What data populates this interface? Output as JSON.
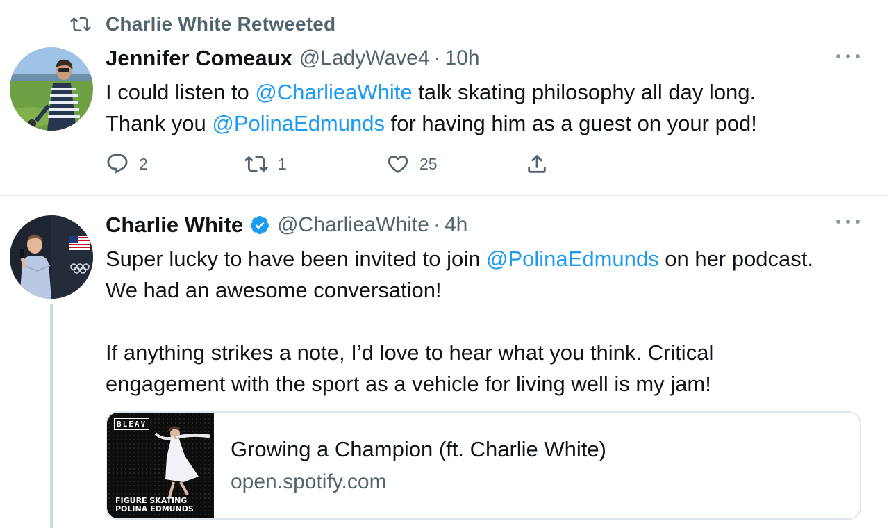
{
  "retweet_context": {
    "icon": "retweet-icon",
    "text": "Charlie White Retweeted"
  },
  "tweets": [
    {
      "name": "Jennifer Comeaux",
      "handle": "@LadyWave4",
      "separator": "·",
      "time": "10h",
      "verified": false,
      "body": {
        "line1_pre": "I could listen to ",
        "line1_mention": "@CharlieaWhite",
        "line1_post": " talk skating philosophy all day long.",
        "line2_pre": "Thank you ",
        "line2_mention": "@PolinaEdmunds",
        "line2_post": " for having him as a guest on your pod!"
      },
      "actions": {
        "reply_count": "2",
        "retweet_count": "1",
        "like_count": "25"
      }
    },
    {
      "name": "Charlie White",
      "handle": "@CharlieaWhite",
      "separator": "·",
      "time": "4h",
      "verified": true,
      "body": {
        "line1_pre": "Super lucky to have been invited to join ",
        "line1_mention": "@PolinaEdmunds",
        "line1_post": " on her podcast.",
        "line2": "We had an awesome conversation!",
        "line3": "If anything strikes a note, I’d love to hear what you think. Critical",
        "line4": "engagement with the sport as a vehicle for living well is my jam!"
      },
      "card": {
        "title": "Growing a Champion (ft. Charlie White)",
        "domain": "open.spotify.com",
        "cover_brand": "BLEAV",
        "cover_line1": "FIGURE SKATING",
        "cover_line2": "POLINA EDMUNDS"
      }
    }
  ],
  "colors": {
    "accent": "#1d9bf0",
    "secondary_text": "#536471",
    "primary_text": "#0f1419",
    "verified": "#1d9bf0",
    "divider": "#e6ecf0"
  }
}
